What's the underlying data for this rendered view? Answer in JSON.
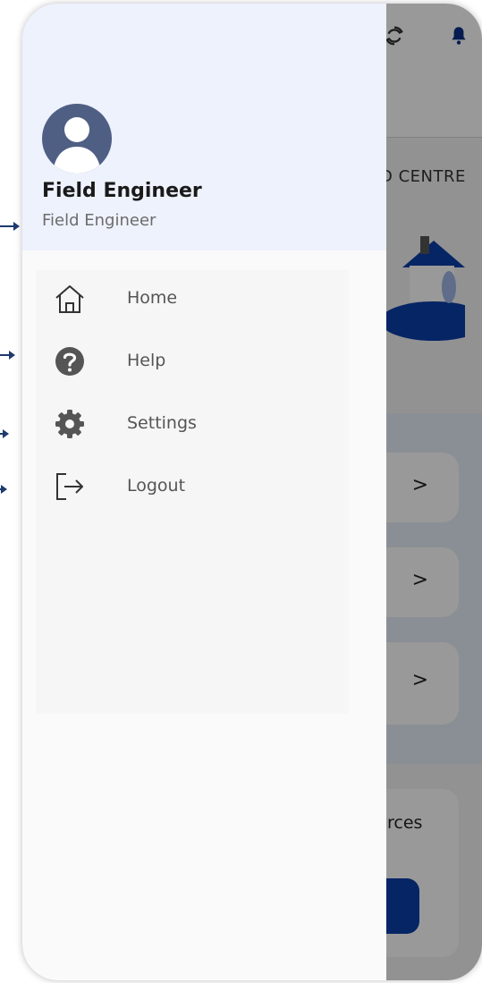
{
  "user": {
    "name": "Field Engineer",
    "role": "Field Engineer",
    "avatar_icon": "person-avatar-icon"
  },
  "menu": {
    "items": [
      {
        "label": "Home",
        "icon": "home-icon"
      },
      {
        "label": "Help",
        "icon": "help-icon"
      },
      {
        "label": "Settings",
        "icon": "gear-icon"
      },
      {
        "label": "Logout",
        "icon": "logout-icon"
      }
    ]
  },
  "background": {
    "tab_text": "D CENTRE",
    "card_chevron": ">",
    "bottom_card_text": "rces"
  },
  "colors": {
    "header_bg": "#eef2fd",
    "avatar_bg": "#4f5f84",
    "accent_blue": "#0b3fa8",
    "arrow": "#1e3a6e"
  }
}
